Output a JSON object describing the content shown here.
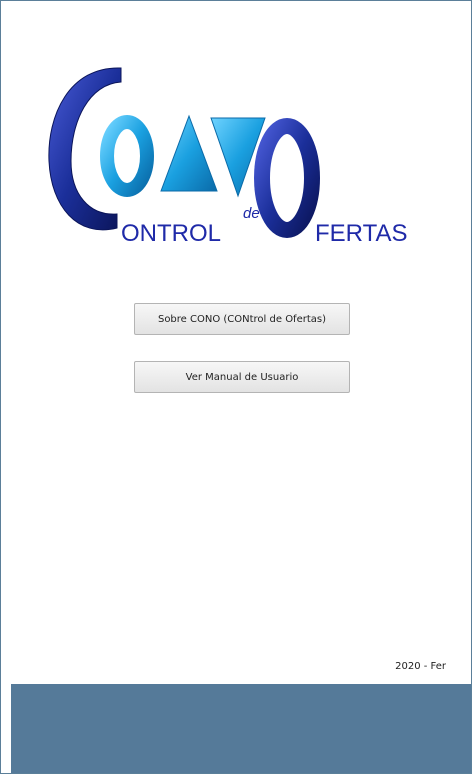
{
  "logo": {
    "alt_word_1": "ONTROL",
    "alt_small": "de",
    "alt_word_2": "FERTAS",
    "colors": {
      "dark_blue": "#1b2f9a",
      "light_blue": "#1aa0e0",
      "text": "#1f2aa8"
    }
  },
  "buttons": {
    "about_label": "Sobre CONO (CONtrol de Ofertas)",
    "manual_label": "Ver Manual de Usuario"
  },
  "footer": {
    "credit": "2020 - Fer",
    "band_color": "#557a99"
  }
}
